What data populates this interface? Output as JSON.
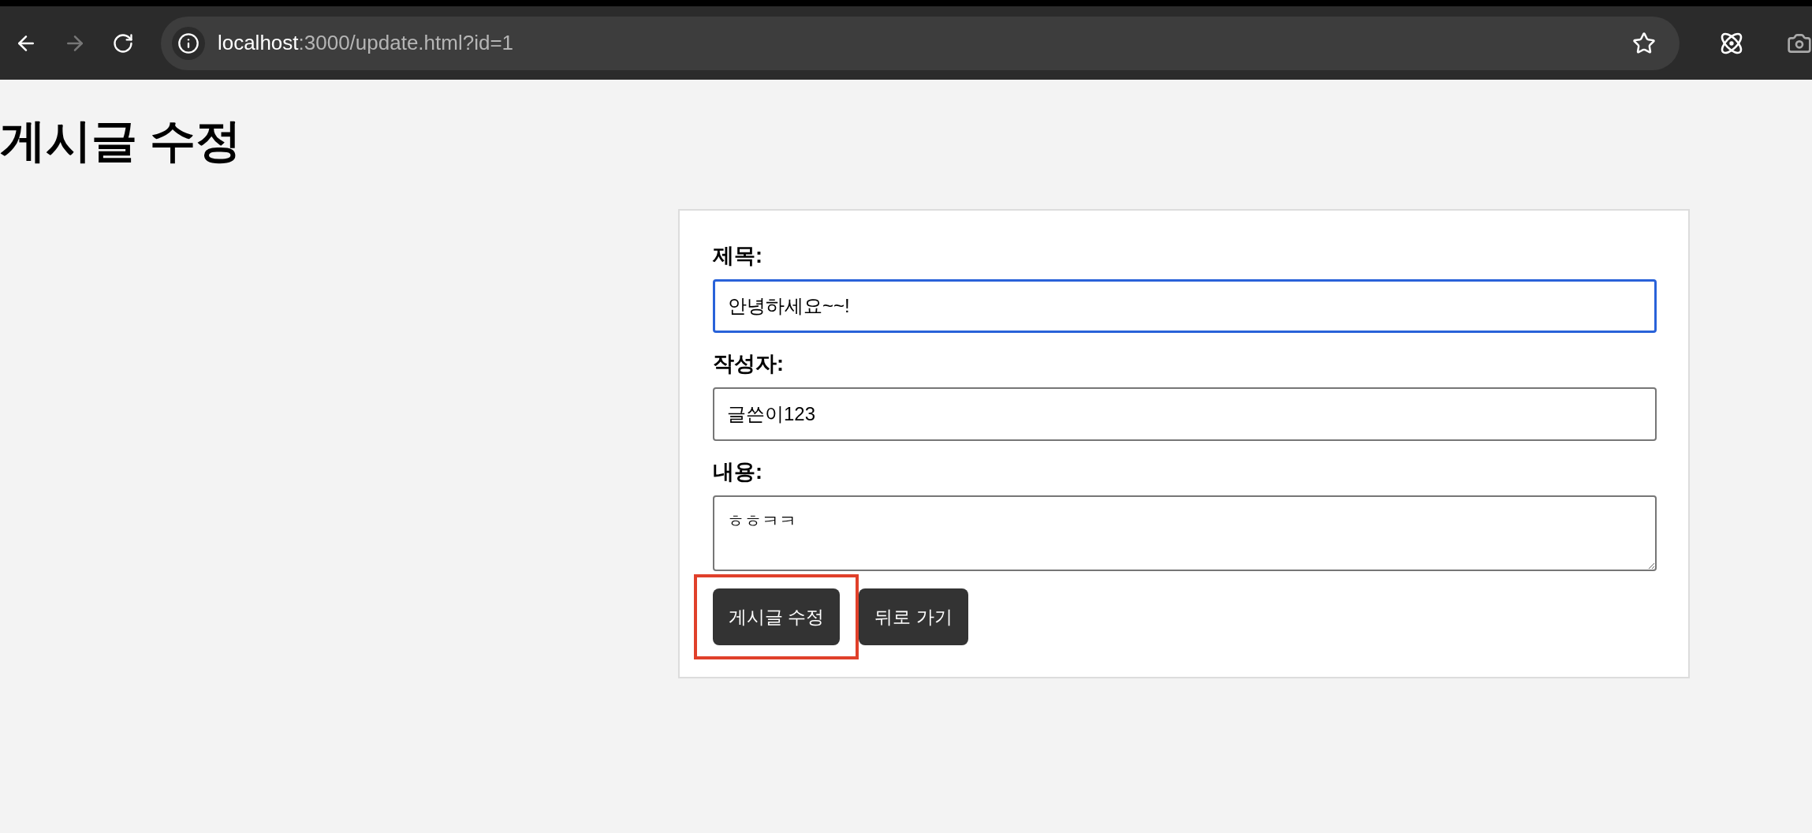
{
  "browser": {
    "back_disabled": false,
    "forward_disabled": true,
    "url_host": "localhost",
    "url_path": ":3000/update.html?id=1"
  },
  "page": {
    "title": "게시글 수정"
  },
  "form": {
    "fields": [
      {
        "kind": "input",
        "label": "제목:",
        "value": "안녕하세요~~!",
        "focused": true
      },
      {
        "kind": "input",
        "label": "작성자:",
        "value": "글쓴이123",
        "focused": false
      },
      {
        "kind": "textarea",
        "label": "내용:",
        "value": "ㅎㅎㅋㅋ",
        "focused": false
      }
    ],
    "buttons": [
      {
        "label": "게시글 수정",
        "highlighted": true
      },
      {
        "label": "뒤로 가기",
        "highlighted": false
      }
    ]
  }
}
